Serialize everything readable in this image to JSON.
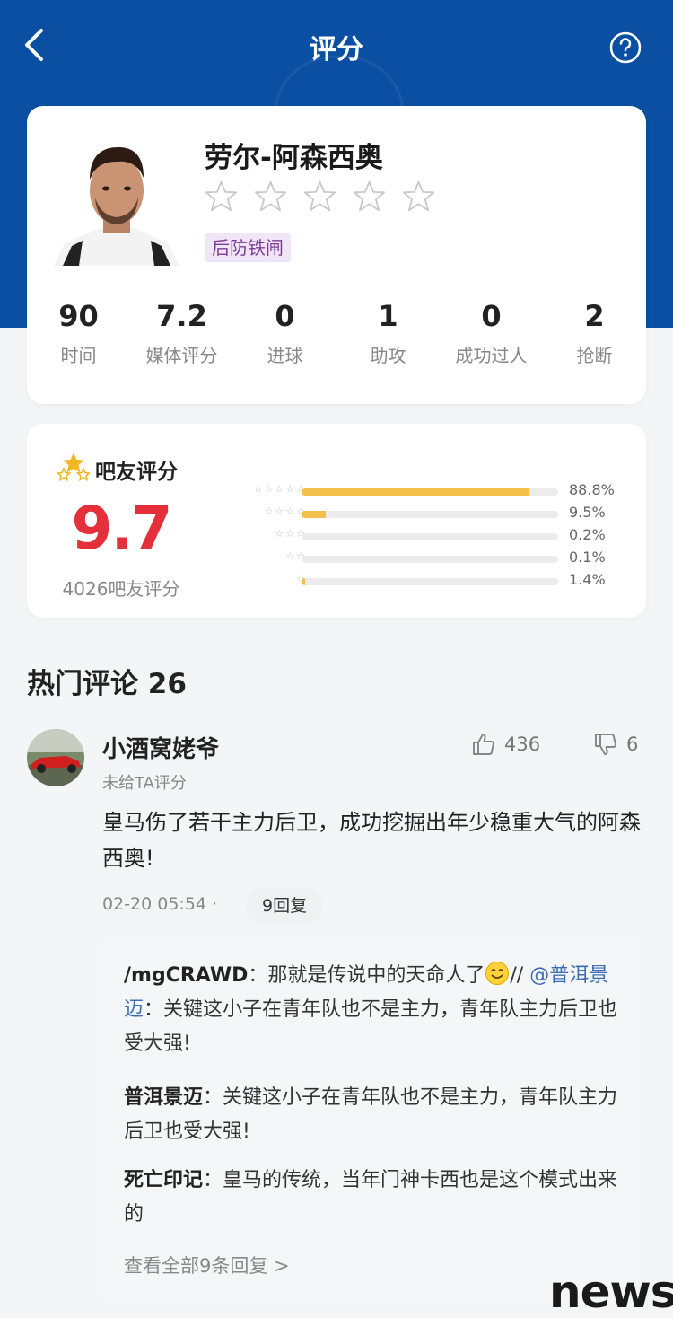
{
  "nav": {
    "title": "评分",
    "back_icon": "back-arrow-icon",
    "help_icon": "question-circle-icon"
  },
  "player": {
    "name": "劳尔-阿森西奥",
    "tag": "后防铁闸",
    "rating_stars": 5,
    "stats": [
      {
        "value": "90",
        "label": "时间"
      },
      {
        "value": "7.2",
        "label": "媒体评分"
      },
      {
        "value": "0",
        "label": "进球"
      },
      {
        "value": "1",
        "label": "助攻"
      },
      {
        "value": "0",
        "label": "成功过人"
      },
      {
        "value": "2",
        "label": "抢断"
      }
    ]
  },
  "fan_rating": {
    "title": "吧友评分",
    "score": "9.7",
    "count_label": "4026吧友评分",
    "distribution": [
      {
        "stars": "☆☆☆☆☆",
        "percent": "88.8%",
        "fraction": 0.888
      },
      {
        "stars": "☆☆☆☆",
        "percent": "9.5%",
        "fraction": 0.095
      },
      {
        "stars": "☆☆☆",
        "percent": "0.2%",
        "fraction": 0.002
      },
      {
        "stars": "☆☆",
        "percent": "0.1%",
        "fraction": 0.001
      },
      {
        "stars": "☆",
        "percent": "1.4%",
        "fraction": 0.014
      }
    ],
    "bar_color": "#f2c04b"
  },
  "hot_comments": {
    "title": "热门评论 26"
  },
  "comment": {
    "user": "小酒窝姥爷",
    "sub": "未给TA评分",
    "likes": "436",
    "dislikes": "6",
    "text": "皇马伤了若干主力后卫，成功挖掘出年少稳重大气的阿森西奥!",
    "time": "02-20 05:54 ·",
    "reply_count": "9回复",
    "replies": {
      "r1_name": "/mgCRAWD",
      "r1_text_a": "：那就是传说中的天命人了",
      "r1_text_b": "// ",
      "r1_mention": "@普洱景迈",
      "r1_text_c": "：关键这小子在青年队也不是主力，青年队主力后卫也受大强!",
      "r2_name": "普洱景迈",
      "r2_text": "：关键这小子在青年队也不是主力，青年队主力后卫也受大强!",
      "r3_name": "死亡印记",
      "r3_text": "：皇马的传统，当年门神卡西也是这个模式出来的"
    },
    "view_all": "查看全部9条回复 >"
  },
  "watermark": "news",
  "colors": {
    "header": "#0b4fa3",
    "score": "#e3303a",
    "tag_bg": "#f1e6f7",
    "tag_fg": "#7d3c98",
    "mention": "#3d6db5"
  }
}
